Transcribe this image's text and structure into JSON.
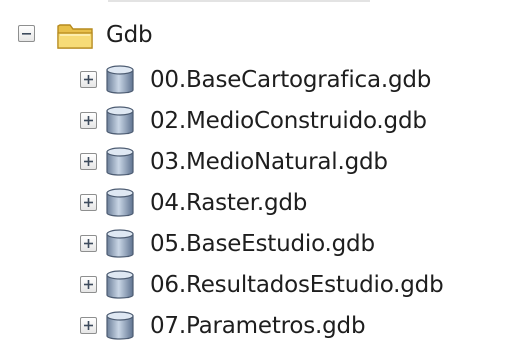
{
  "tree": {
    "root": {
      "label": "Gdb",
      "expander_state": "collapse",
      "icon": "folder-icon"
    },
    "children": [
      {
        "label": "00.BaseCartografica.gdb",
        "expander_state": "expand",
        "icon": "database-icon"
      },
      {
        "label": "02.MedioConstruido.gdb",
        "expander_state": "expand",
        "icon": "database-icon"
      },
      {
        "label": "03.MedioNatural.gdb",
        "expander_state": "expand",
        "icon": "database-icon"
      },
      {
        "label": "04.Raster.gdb",
        "expander_state": "expand",
        "icon": "database-icon"
      },
      {
        "label": "05.BaseEstudio.gdb",
        "expander_state": "expand",
        "icon": "database-icon"
      },
      {
        "label": "06.ResultadosEstudio.gdb",
        "expander_state": "expand",
        "icon": "database-icon"
      },
      {
        "label": "07.Parametros.gdb",
        "expander_state": "expand",
        "icon": "database-icon"
      }
    ]
  }
}
